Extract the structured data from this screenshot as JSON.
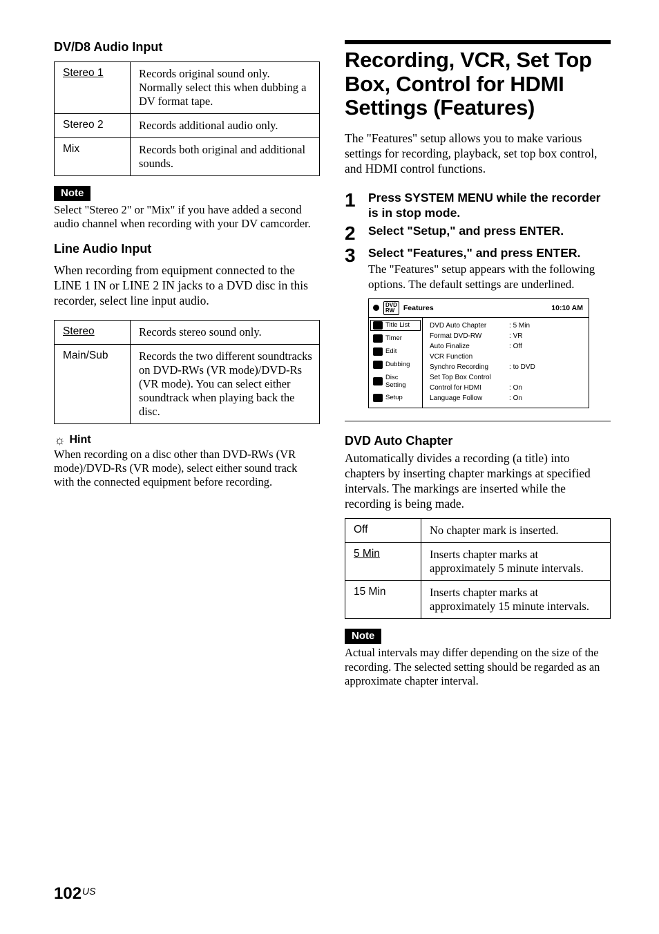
{
  "left": {
    "dv_heading": "DV/D8 Audio Input",
    "dv_table": [
      {
        "key": "Stereo 1",
        "underline": true,
        "val": "Records original sound only. Normally select this when dubbing a DV format tape."
      },
      {
        "key": "Stereo 2",
        "underline": false,
        "val": "Records additional audio only."
      },
      {
        "key": "Mix",
        "underline": false,
        "val": "Records both original and additional sounds."
      }
    ],
    "note_label": "Note",
    "dv_note": "Select \"Stereo 2\" or \"Mix\" if you have added a second audio channel when recording with your DV camcorder.",
    "line_heading": "Line Audio Input",
    "line_intro": "When recording from equipment connected to the LINE 1 IN or LINE 2 IN jacks to a DVD disc in this recorder, select line input audio.",
    "line_table": [
      {
        "key": "Stereo",
        "underline": true,
        "val": "Records stereo sound only."
      },
      {
        "key": "Main/Sub",
        "underline": false,
        "val": "Records the two different soundtracks on DVD-RWs (VR mode)/DVD-Rs (VR mode). You can select either soundtrack when playing back the disc."
      }
    ],
    "hint_label": "Hint",
    "hint_text": "When recording on a disc other than DVD-RWs (VR mode)/DVD-Rs (VR mode), select either sound track with the connected equipment before recording."
  },
  "right": {
    "title": "Recording, VCR, Set Top Box, Control for HDMI Settings (Features)",
    "intro": "The \"Features\" setup allows you to make various settings for recording, playback, set top box control, and HDMI control functions.",
    "steps": [
      {
        "n": "1",
        "head": "Press SYSTEM MENU while the recorder is in stop mode.",
        "sub": ""
      },
      {
        "n": "2",
        "head": "Select \"Setup,\" and press ENTER.",
        "sub": ""
      },
      {
        "n": "3",
        "head": "Select \"Features,\" and press ENTER.",
        "sub": "The \"Features\" setup appears with the following options. The default settings are underlined."
      }
    ],
    "screen": {
      "header_label": "Features",
      "header_time": "10:10 AM",
      "side_items": [
        {
          "label": "Title List",
          "selected": true
        },
        {
          "label": "Timer"
        },
        {
          "label": "Edit"
        },
        {
          "label": "Dubbing"
        },
        {
          "label": "Disc Setting"
        },
        {
          "label": "Setup"
        }
      ],
      "rows": [
        {
          "label": "DVD Auto Chapter",
          "val": "5 Min"
        },
        {
          "label": "Format DVD-RW",
          "val": "VR"
        },
        {
          "label": "Auto Finalize",
          "val": "Off"
        },
        {
          "label": "VCR Function",
          "val": ""
        },
        {
          "label": "Synchro Recording",
          "val": "to DVD"
        },
        {
          "label": "Set Top Box Control",
          "val": ""
        },
        {
          "label": "Control for HDMI",
          "val": "On"
        },
        {
          "label": "Language Follow",
          "val": "On"
        }
      ]
    },
    "dvd_auto_h": "DVD Auto Chapter",
    "dvd_auto_p": "Automatically divides a recording (a title) into chapters by inserting chapter markings at specified intervals. The markings are inserted while the recording is being made.",
    "dvd_auto_table": [
      {
        "key": "Off",
        "underline": false,
        "val": "No chapter mark is inserted."
      },
      {
        "key": "5 Min",
        "underline": true,
        "val": "Inserts chapter marks at approximately 5 minute intervals."
      },
      {
        "key": "15 Min",
        "underline": false,
        "val": "Inserts chapter marks at approximately 15 minute intervals."
      }
    ],
    "note_label": "Note",
    "dvd_auto_note": "Actual intervals may differ depending on the size of the recording. The selected setting should be regarded as an approximate chapter interval."
  },
  "footer": {
    "page": "102",
    "region": "US"
  }
}
